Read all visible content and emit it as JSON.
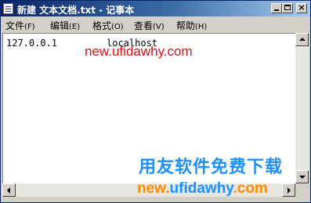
{
  "window": {
    "title": "新建 文本文档.txt - 记事本",
    "controls": {
      "minimize_icon": "minimize-icon",
      "maximize_icon": "maximize-icon",
      "close_glyph": "×"
    }
  },
  "menu": [
    {
      "label": "文件",
      "accel": "(F)"
    },
    {
      "label": "编辑",
      "accel": "(E)"
    },
    {
      "label": "格式",
      "accel": "(O)"
    },
    {
      "label": "查看",
      "accel": "(V)"
    },
    {
      "label": "帮助",
      "accel": "(H)"
    }
  ],
  "editor": {
    "ip": "127.0.0.1",
    "hostname": "localhost"
  },
  "watermarks": {
    "top_url": "new.ufidawhy.com",
    "cn_text": "用友软件免费下载",
    "bottom_new": "new",
    "bottom_dot": ".",
    "bottom_host": "ufidawhy",
    "bottom_com": ".com"
  },
  "colors": {
    "titlebar_start": "#0a246a",
    "titlebar_end": "#a6caf0",
    "watermark_red": "#e01010",
    "watermark_blue": "#1e90ff",
    "watermark_orange": "#ff8c00"
  }
}
